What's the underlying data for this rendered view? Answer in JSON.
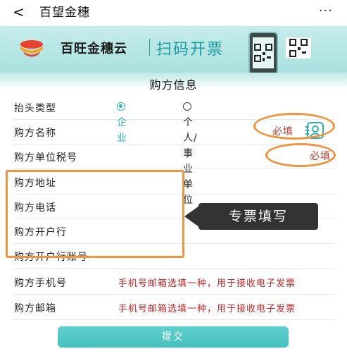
{
  "nav": {
    "back_glyph": "<",
    "title": "百望金穗",
    "more_glyph": "···"
  },
  "banner": {
    "brand": "百旺金穗云",
    "slogan": "扫码开票",
    "colors": {
      "teal": "#1e9aa0",
      "logo_red": "#e8412f",
      "logo_orange": "#f7a21b"
    }
  },
  "form": {
    "section_title": "购方信息",
    "rows": [
      {
        "label": "抬头类型"
      },
      {
        "label": "购方名称",
        "required": "必填"
      },
      {
        "label": "购方单位税号",
        "required": "必填"
      },
      {
        "label": "购方地址"
      },
      {
        "label": "购方电话"
      },
      {
        "label": "购方开户行"
      },
      {
        "label": "购方开户行账号"
      },
      {
        "label": "购方手机号",
        "hint": "手机号邮箱选填一种，用于接收电子发票"
      },
      {
        "label": "购方邮箱",
        "hint": "手机号邮箱选填一种，用于接收电子发票"
      }
    ],
    "title_type_options": [
      {
        "label": "企业",
        "selected": true
      },
      {
        "label": "个人/事业单位",
        "selected": false
      }
    ],
    "icons": {
      "name_field_icon": "contact-card-icon"
    }
  },
  "annotation": {
    "tooltip": "专票填写",
    "color": "#f0943d"
  },
  "submit": {
    "label": "提交",
    "color": "#4cc6c4"
  }
}
